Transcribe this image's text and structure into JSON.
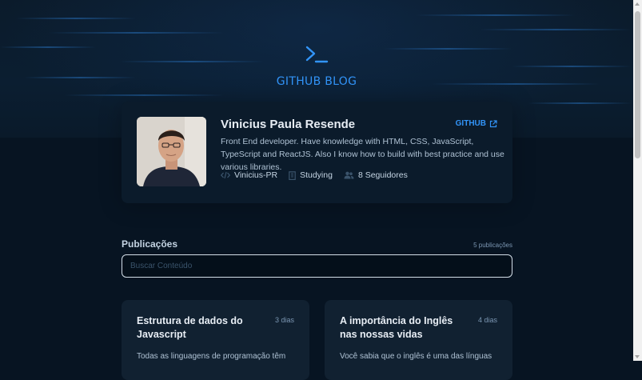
{
  "brand": {
    "title": "GITHUB BLOG",
    "icon": "terminal-icon"
  },
  "profile": {
    "name": "Vinicius Paula Resende",
    "github_label": "GITHUB",
    "bio": "Front End developer. Have knowledge with HTML, CSS, JavaScript, TypeScript and ReactJS. Also I know how to build with best practice and use various libraries.",
    "username": "Vinicius-PR",
    "company": "Studying",
    "followers": "8 Seguidores"
  },
  "publications": {
    "title": "Publicações",
    "count": "5 publicações",
    "search_placeholder": "Buscar Conteúdo"
  },
  "posts": [
    {
      "title": "Estrutura de dados do Javascript",
      "age": "3 dias",
      "excerpt": "Todas as linguagens de programação têm"
    },
    {
      "title": "A importância do Inglês nas nossas vidas",
      "age": "4 dias",
      "excerpt": "Você sabia que o inglês é uma das línguas"
    }
  ],
  "colors": {
    "background": "#071422",
    "card": "#0B1B2B",
    "post_card": "#112131",
    "accent": "#3294F8",
    "title": "#E7EDF4",
    "text": "#AFC2D4"
  }
}
